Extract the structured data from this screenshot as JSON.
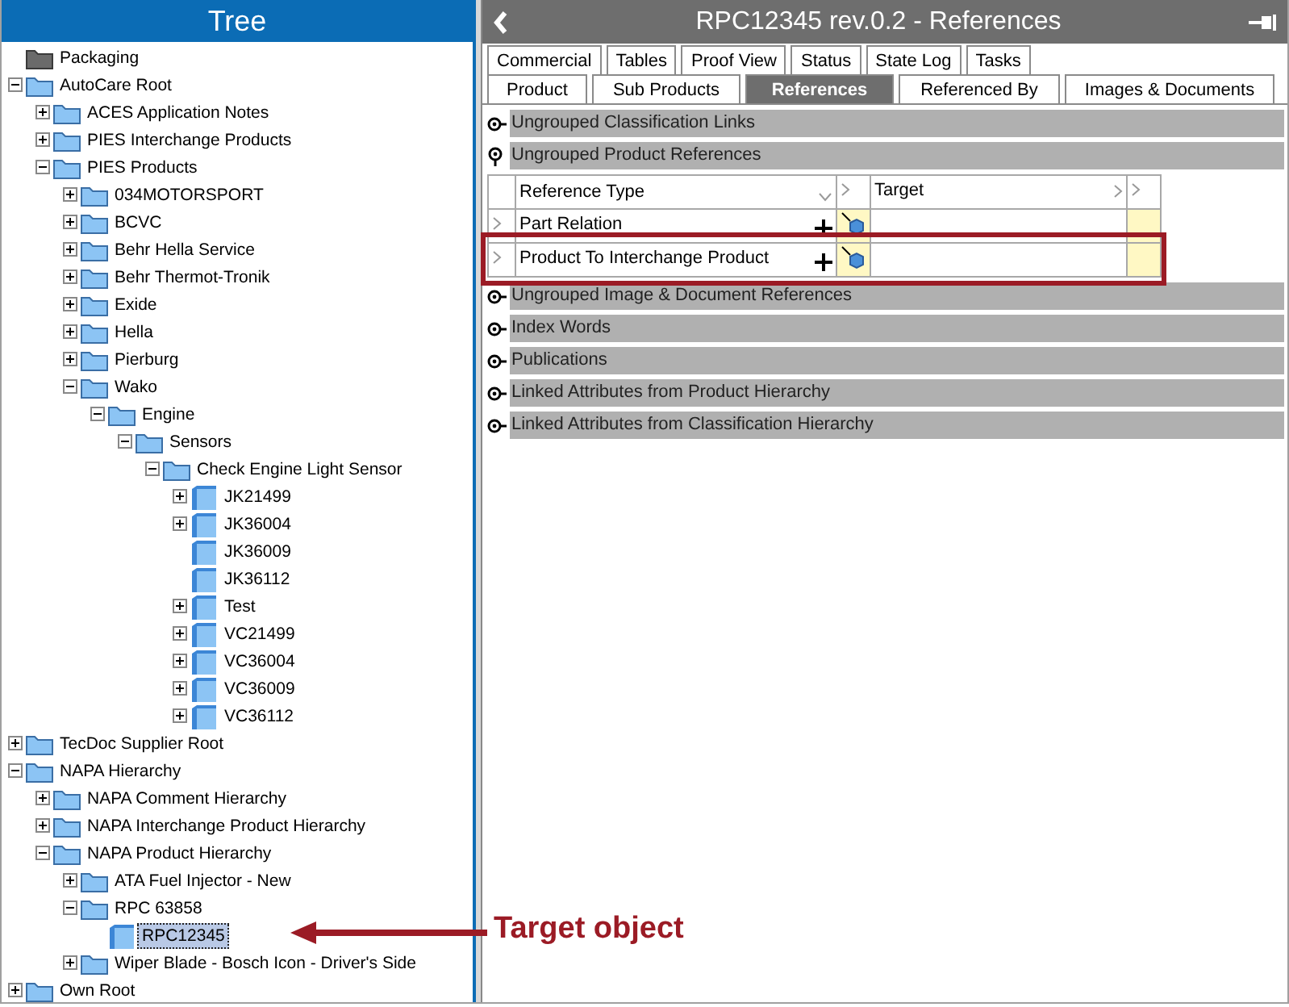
{
  "tree": {
    "title": "Tree",
    "nodes": [
      {
        "label": "Packaging",
        "kind": "packaging",
        "expandable": false,
        "selected": false
      },
      {
        "label": "AutoCare Root",
        "kind": "folder",
        "expandable": true,
        "expanded": true,
        "selected": false,
        "children": [
          {
            "label": "ACES Application Notes",
            "kind": "folder",
            "expandable": true,
            "expanded": false,
            "selected": false
          },
          {
            "label": "PIES Interchange Products",
            "kind": "folder",
            "expandable": true,
            "expanded": false,
            "selected": false
          },
          {
            "label": "PIES Products",
            "kind": "folder",
            "expandable": true,
            "expanded": true,
            "selected": false,
            "children": [
              {
                "label": "034MOTORSPORT",
                "kind": "folder",
                "expandable": true,
                "expanded": false,
                "selected": false
              },
              {
                "label": "BCVC",
                "kind": "folder",
                "expandable": true,
                "expanded": false,
                "selected": false
              },
              {
                "label": "Behr Hella Service",
                "kind": "folder",
                "expandable": true,
                "expanded": false,
                "selected": false
              },
              {
                "label": "Behr Thermot-Tronik",
                "kind": "folder",
                "expandable": true,
                "expanded": false,
                "selected": false
              },
              {
                "label": "Exide",
                "kind": "folder",
                "expandable": true,
                "expanded": false,
                "selected": false
              },
              {
                "label": "Hella",
                "kind": "folder",
                "expandable": true,
                "expanded": false,
                "selected": false
              },
              {
                "label": "Pierburg",
                "kind": "folder",
                "expandable": true,
                "expanded": false,
                "selected": false
              },
              {
                "label": "Wako",
                "kind": "folder",
                "expandable": true,
                "expanded": true,
                "selected": false,
                "children": [
                  {
                    "label": "Engine",
                    "kind": "folder",
                    "expandable": true,
                    "expanded": true,
                    "selected": false,
                    "children": [
                      {
                        "label": "Sensors",
                        "kind": "folder",
                        "expandable": true,
                        "expanded": true,
                        "selected": false,
                        "children": [
                          {
                            "label": "Check Engine Light Sensor",
                            "kind": "folder",
                            "expandable": true,
                            "expanded": true,
                            "selected": false,
                            "children": [
                              {
                                "label": "JK21499",
                                "kind": "product",
                                "expandable": true,
                                "expanded": false,
                                "selected": false
                              },
                              {
                                "label": "JK36004",
                                "kind": "product",
                                "expandable": true,
                                "expanded": false,
                                "selected": false
                              },
                              {
                                "label": "JK36009",
                                "kind": "product",
                                "expandable": false,
                                "selected": false
                              },
                              {
                                "label": "JK36112",
                                "kind": "product",
                                "expandable": false,
                                "selected": false
                              },
                              {
                                "label": "Test",
                                "kind": "product",
                                "expandable": true,
                                "expanded": false,
                                "selected": false
                              },
                              {
                                "label": "VC21499",
                                "kind": "product",
                                "expandable": true,
                                "expanded": false,
                                "selected": false
                              },
                              {
                                "label": "VC36004",
                                "kind": "product",
                                "expandable": true,
                                "expanded": false,
                                "selected": false
                              },
                              {
                                "label": "VC36009",
                                "kind": "product",
                                "expandable": true,
                                "expanded": false,
                                "selected": false
                              },
                              {
                                "label": "VC36112",
                                "kind": "product",
                                "expandable": true,
                                "expanded": false,
                                "selected": false
                              }
                            ]
                          }
                        ]
                      }
                    ]
                  }
                ]
              }
            ]
          }
        ]
      },
      {
        "label": "TecDoc Supplier Root",
        "kind": "folder",
        "expandable": true,
        "expanded": false,
        "selected": false
      },
      {
        "label": "NAPA Hierarchy",
        "kind": "folder",
        "expandable": true,
        "expanded": true,
        "selected": false,
        "children": [
          {
            "label": "NAPA Comment Hierarchy",
            "kind": "folder",
            "expandable": true,
            "expanded": false,
            "selected": false
          },
          {
            "label": "NAPA Interchange Product Hierarchy",
            "kind": "folder",
            "expandable": true,
            "expanded": false,
            "selected": false
          },
          {
            "label": "NAPA Product Hierarchy",
            "kind": "folder",
            "expandable": true,
            "expanded": true,
            "selected": false,
            "children": [
              {
                "label": "ATA Fuel Injector - New",
                "kind": "folder",
                "expandable": true,
                "expanded": false,
                "selected": false
              },
              {
                "label": "RPC 63858",
                "kind": "folder",
                "expandable": true,
                "expanded": true,
                "selected": false,
                "children": [
                  {
                    "label": "RPC12345",
                    "kind": "product",
                    "expandable": false,
                    "selected": true
                  }
                ]
              },
              {
                "label": "Wiper Blade - Bosch Icon - Driver's Side",
                "kind": "folder",
                "expandable": true,
                "expanded": false,
                "selected": false
              }
            ]
          }
        ]
      },
      {
        "label": "Own Root",
        "kind": "folder",
        "expandable": true,
        "expanded": false,
        "selected": false
      }
    ]
  },
  "editor": {
    "title": "RPC12345 rev.0.2 - References",
    "tab_rows": [
      [
        {
          "label": "Commercial",
          "selected": false
        },
        {
          "label": "Tables",
          "selected": false
        },
        {
          "label": "Proof View",
          "selected": false
        },
        {
          "label": "Status",
          "selected": false
        },
        {
          "label": "State Log",
          "selected": false
        },
        {
          "label": "Tasks",
          "selected": false
        }
      ],
      [
        {
          "label": "Product",
          "selected": false
        },
        {
          "label": "Sub Products",
          "selected": false
        },
        {
          "label": "References",
          "selected": true
        },
        {
          "label": "Referenced By",
          "selected": false
        },
        {
          "label": "Images & Documents",
          "selected": false
        }
      ]
    ],
    "sections": [
      {
        "title": "Ungrouped Classification Links",
        "expanded": false
      },
      {
        "title": "Ungrouped Product References",
        "expanded": true,
        "table": {
          "columns": [
            "Reference Type",
            "Target"
          ],
          "rows": [
            {
              "reference_type": "Part Relation",
              "highlighted": false
            },
            {
              "reference_type": "Product To Interchange Product",
              "highlighted": true
            }
          ]
        }
      },
      {
        "title": "Ungrouped Image & Document References",
        "expanded": false
      },
      {
        "title": "Index Words",
        "expanded": false
      },
      {
        "title": "Publications",
        "expanded": false
      },
      {
        "title": "Linked Attributes from Product Hierarchy",
        "expanded": false
      },
      {
        "title": "Linked Attributes from Classification Hierarchy",
        "expanded": false
      }
    ]
  },
  "annotation": {
    "label": "Target object"
  }
}
